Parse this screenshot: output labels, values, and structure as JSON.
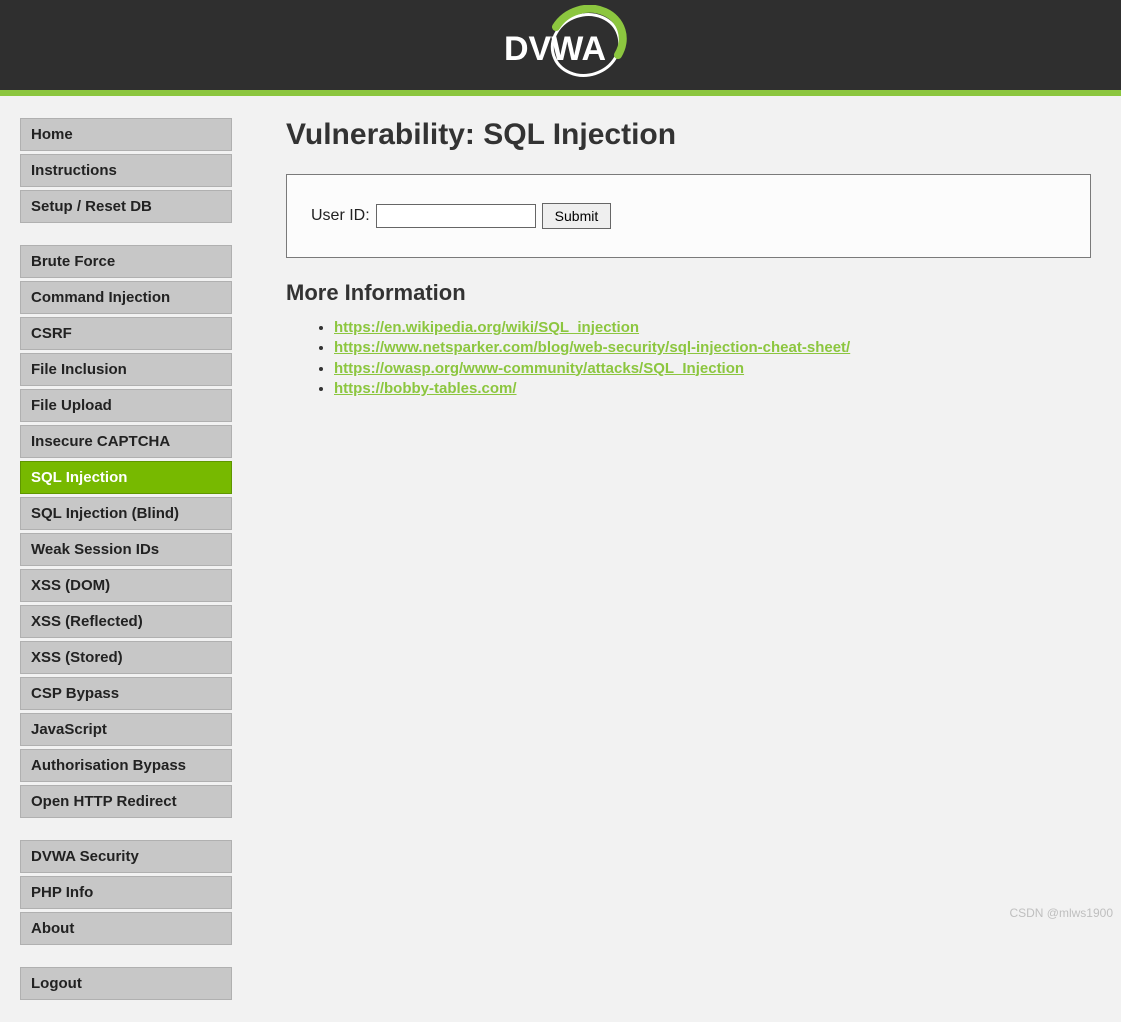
{
  "header": {
    "logo_text": "DVWA"
  },
  "sidebar": {
    "groups": [
      {
        "items": [
          {
            "label": "Home"
          },
          {
            "label": "Instructions"
          },
          {
            "label": "Setup / Reset DB"
          }
        ]
      },
      {
        "items": [
          {
            "label": "Brute Force"
          },
          {
            "label": "Command Injection"
          },
          {
            "label": "CSRF"
          },
          {
            "label": "File Inclusion"
          },
          {
            "label": "File Upload"
          },
          {
            "label": "Insecure CAPTCHA"
          },
          {
            "label": "SQL Injection",
            "selected": true
          },
          {
            "label": "SQL Injection (Blind)"
          },
          {
            "label": "Weak Session IDs"
          },
          {
            "label": "XSS (DOM)"
          },
          {
            "label": "XSS (Reflected)"
          },
          {
            "label": "XSS (Stored)"
          },
          {
            "label": "CSP Bypass"
          },
          {
            "label": "JavaScript"
          },
          {
            "label": "Authorisation Bypass"
          },
          {
            "label": "Open HTTP Redirect"
          }
        ]
      },
      {
        "items": [
          {
            "label": "DVWA Security"
          },
          {
            "label": "PHP Info"
          },
          {
            "label": "About"
          }
        ]
      },
      {
        "items": [
          {
            "label": "Logout"
          }
        ]
      }
    ]
  },
  "main": {
    "title": "Vulnerability: SQL Injection",
    "form": {
      "label": "User ID:",
      "value": "",
      "submit_label": "Submit"
    },
    "more_info_heading": "More Information",
    "links": [
      "https://en.wikipedia.org/wiki/SQL_injection",
      "https://www.netsparker.com/blog/web-security/sql-injection-cheat-sheet/",
      "https://owasp.org/www-community/attacks/SQL_Injection",
      "https://bobby-tables.com/"
    ]
  },
  "watermark": "CSDN @mlws1900"
}
